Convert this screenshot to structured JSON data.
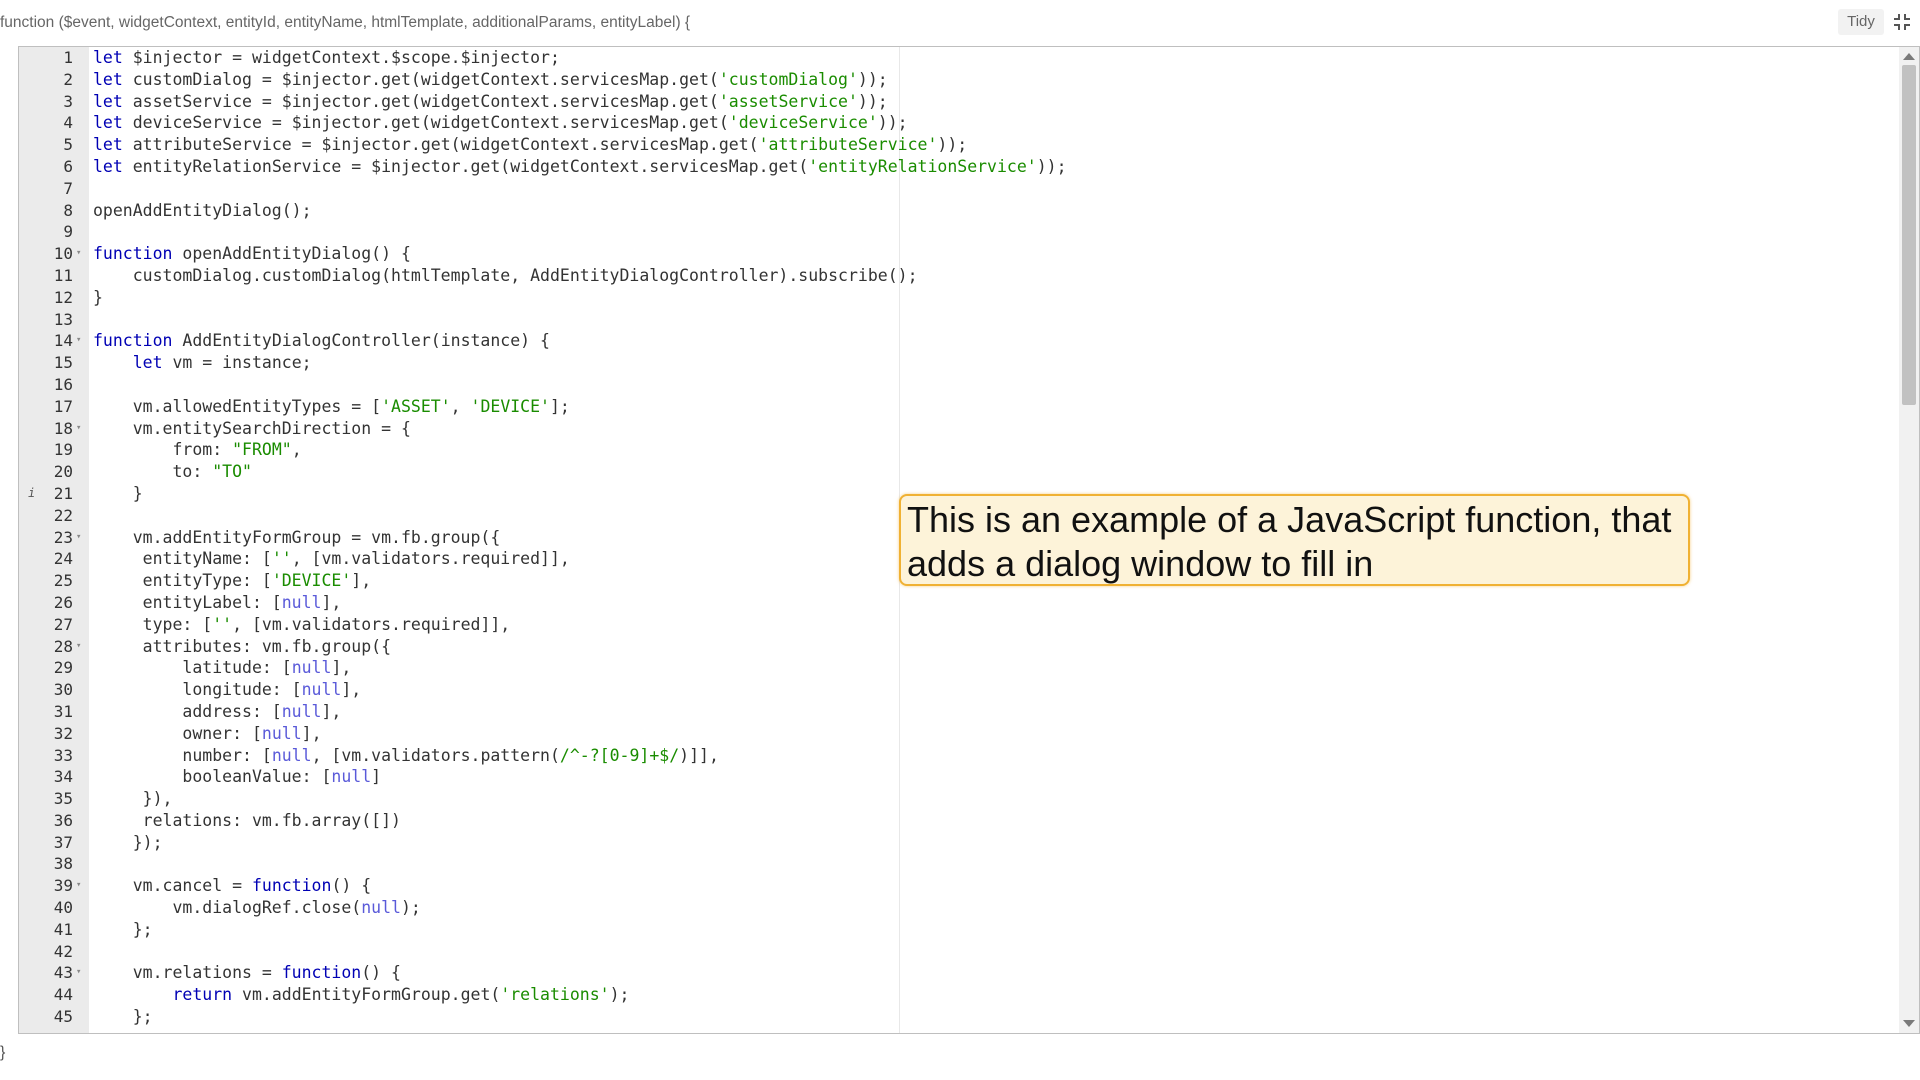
{
  "header": {
    "signature": "function ($event, widgetContext, entityId, entityName, htmlTemplate, additionalParams, entityLabel) {",
    "tidy_label": "Tidy"
  },
  "editor": {
    "lines": [
      {
        "n": "1",
        "t": "let $injector = widgetContext.$scope.$injector;"
      },
      {
        "n": "2",
        "t": "let customDialog = $injector.get(widgetContext.servicesMap.get('customDialog'));"
      },
      {
        "n": "3",
        "t": "let assetService = $injector.get(widgetContext.servicesMap.get('assetService'));"
      },
      {
        "n": "4",
        "t": "let deviceService = $injector.get(widgetContext.servicesMap.get('deviceService'));"
      },
      {
        "n": "5",
        "t": "let attributeService = $injector.get(widgetContext.servicesMap.get('attributeService'));"
      },
      {
        "n": "6",
        "t": "let entityRelationService = $injector.get(widgetContext.servicesMap.get('entityRelationService'));"
      },
      {
        "n": "7",
        "t": ""
      },
      {
        "n": "8",
        "t": "openAddEntityDialog();"
      },
      {
        "n": "9",
        "t": ""
      },
      {
        "n": "10",
        "t": "function openAddEntityDialog() {",
        "fold": true
      },
      {
        "n": "11",
        "t": "    customDialog.customDialog(htmlTemplate, AddEntityDialogController).subscribe();"
      },
      {
        "n": "12",
        "t": "}"
      },
      {
        "n": "13",
        "t": ""
      },
      {
        "n": "14",
        "t": "function AddEntityDialogController(instance) {",
        "fold": true
      },
      {
        "n": "15",
        "t": "    let vm = instance;"
      },
      {
        "n": "16",
        "t": ""
      },
      {
        "n": "17",
        "t": "    vm.allowedEntityTypes = ['ASSET', 'DEVICE'];"
      },
      {
        "n": "18",
        "t": "    vm.entitySearchDirection = {",
        "fold": true
      },
      {
        "n": "19",
        "t": "        from: \"FROM\","
      },
      {
        "n": "20",
        "t": "        to: \"TO\""
      },
      {
        "n": "21",
        "t": "    }",
        "info": true
      },
      {
        "n": "22",
        "t": ""
      },
      {
        "n": "23",
        "t": "    vm.addEntityFormGroup = vm.fb.group({",
        "fold": true
      },
      {
        "n": "24",
        "t": "     entityName: ['', [vm.validators.required]],"
      },
      {
        "n": "25",
        "t": "     entityType: ['DEVICE'],"
      },
      {
        "n": "26",
        "t": "     entityLabel: [null],"
      },
      {
        "n": "27",
        "t": "     type: ['', [vm.validators.required]],"
      },
      {
        "n": "28",
        "t": "     attributes: vm.fb.group({",
        "fold": true
      },
      {
        "n": "29",
        "t": "         latitude: [null],"
      },
      {
        "n": "30",
        "t": "         longitude: [null],"
      },
      {
        "n": "31",
        "t": "         address: [null],"
      },
      {
        "n": "32",
        "t": "         owner: [null],"
      },
      {
        "n": "33",
        "t": "         number: [null, [vm.validators.pattern(/^-?[0-9]+$/)]],"
      },
      {
        "n": "34",
        "t": "         booleanValue: [null]"
      },
      {
        "n": "35",
        "t": "     }),"
      },
      {
        "n": "36",
        "t": "     relations: vm.fb.array([])"
      },
      {
        "n": "37",
        "t": "    });"
      },
      {
        "n": "38",
        "t": ""
      },
      {
        "n": "39",
        "t": "    vm.cancel = function() {",
        "fold": true
      },
      {
        "n": "40",
        "t": "        vm.dialogRef.close(null);"
      },
      {
        "n": "41",
        "t": "    };"
      },
      {
        "n": "42",
        "t": ""
      },
      {
        "n": "43",
        "t": "    vm.relations = function() {",
        "fold": true
      },
      {
        "n": "44",
        "t": "        return vm.addEntityFormGroup.get('relations');"
      },
      {
        "n": "45",
        "t": "    };"
      }
    ]
  },
  "footer": {
    "closing_brace": "}"
  },
  "callout": {
    "text": "This is an example of a JavaScript function, that adds a dialog window to fill in"
  },
  "colors": {
    "keyword": "#0000b4",
    "string": "#1a8c00",
    "null": "#5a5ad9",
    "callout_border": "#f0b133",
    "callout_bg": "#fdf3d9"
  }
}
